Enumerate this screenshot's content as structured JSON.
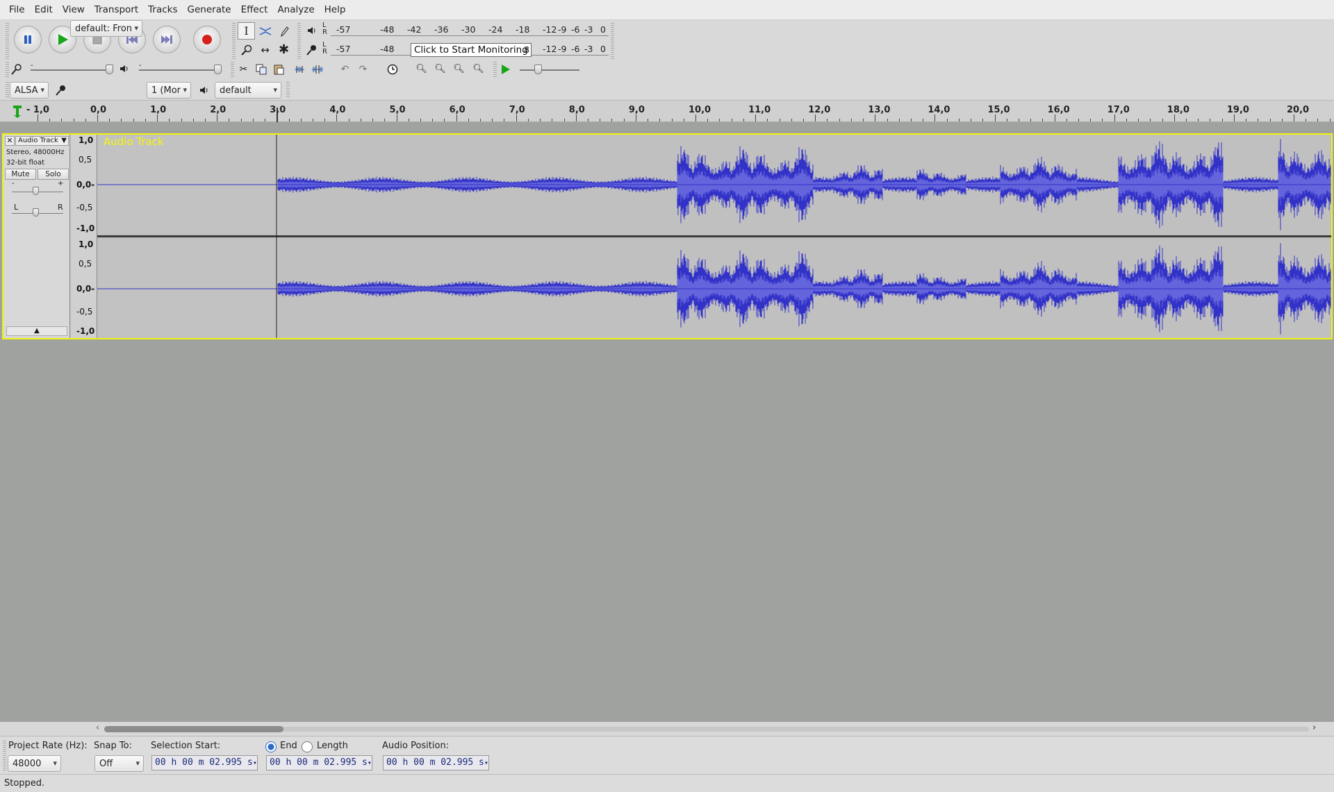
{
  "menu": {
    "items": [
      "File",
      "Edit",
      "View",
      "Transport",
      "Tracks",
      "Generate",
      "Effect",
      "Analyze",
      "Help"
    ]
  },
  "transport": {
    "buttons": [
      "pause",
      "play",
      "stop",
      "skip-start",
      "skip-end",
      "record"
    ],
    "accent_record": "#d6201a",
    "accent_play": "#19a419"
  },
  "meters": {
    "playback_ticks": [
      "-57",
      "-48",
      "-42",
      "-36",
      "-30",
      "-24",
      "-18",
      "-12",
      "-9",
      "-6",
      "-3",
      "0"
    ],
    "record_ticks": [
      "-57",
      "-48",
      "-12",
      "-9",
      "-6",
      "-3",
      "0"
    ],
    "lr_top": "L",
    "lr_bottom": "R",
    "tooltip": "Click to Start Monitoring",
    "tooltip_tail": "8"
  },
  "devices": {
    "host": "ALSA",
    "recording_device": "default: Fron",
    "channels": "1 (Mor",
    "playback_device": "default"
  },
  "ruler": {
    "labels": [
      "- 1,0",
      "0,0",
      "1,0",
      "2,0",
      "3,0",
      "4,0",
      "5,0",
      "6,0",
      "7,0",
      "8,0",
      "9,0",
      "10,0",
      "11,0",
      "12,0",
      "13,0",
      "14,0",
      "15,0",
      "16,0",
      "17,0",
      "18,0",
      "19,0",
      "20,0"
    ]
  },
  "track": {
    "name": "Audio Track",
    "menu_label": "Audio Track",
    "info_line1": "Stereo, 48000Hz",
    "info_line2": "32-bit float",
    "mute": "Mute",
    "solo": "Solo",
    "gain_minus": "-",
    "gain_plus": "+",
    "pan_left": "L",
    "pan_right": "R",
    "axis": [
      "1,0",
      "0,5",
      "0,0-",
      "-0,5",
      "-1,0"
    ],
    "waveform_color": "#3232c8",
    "name_color": "#f5f50a"
  },
  "selection": {
    "project_rate_label": "Project Rate (Hz):",
    "project_rate": "48000",
    "snap_to_label": "Snap To:",
    "snap_to": "Off",
    "selection_start_label": "Selection Start:",
    "end_label": "End",
    "length_label": "Length",
    "audio_position_label": "Audio Position:",
    "selection_start": "00 h 00 m 02.995 s",
    "selection_end": "00 h 00 m 02.995 s",
    "audio_position": "00 h 00 m 02.995 s"
  },
  "status": "Stopped."
}
